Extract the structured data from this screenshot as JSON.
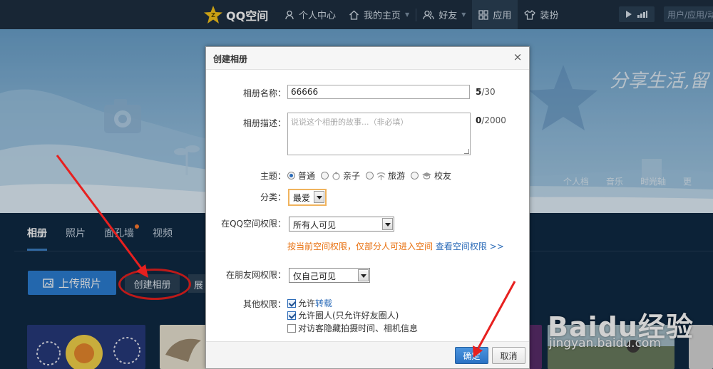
{
  "topbar": {
    "logo_text": "QQ空间",
    "nav": [
      {
        "label": "个人中心",
        "icon": "user-icon"
      },
      {
        "label": "我的主页",
        "icon": "home-icon"
      },
      {
        "label": "好友",
        "icon": "friends-icon"
      },
      {
        "label": "应用",
        "icon": "apps-grid-icon",
        "active": true
      },
      {
        "label": "装扮",
        "icon": "shirt-icon"
      }
    ],
    "search_placeholder": "用户/应用/动"
  },
  "hero": {
    "slogan": "分享生活,留",
    "tabs": [
      "个人档",
      "音乐",
      "时光轴",
      "更"
    ]
  },
  "album_page": {
    "tabs": [
      "相册",
      "照片",
      "面孔墙",
      "视频"
    ],
    "active_tab": "相册",
    "upload_label": "上传照片",
    "create_album_label": "创建相册",
    "more_label": "展"
  },
  "dialog": {
    "title": "创建相册",
    "close_symbol": "×",
    "name_label": "相册名称：",
    "name_value": "66666",
    "name_count": "5",
    "name_max": "/30",
    "desc_label": "相册描述：",
    "desc_placeholder": "说说这个相册的故事...（非必填）",
    "desc_count": "0",
    "desc_max": "/2000",
    "theme_label": "主题：",
    "themes": [
      "普通",
      "亲子",
      "旅游",
      "校友"
    ],
    "selected_theme": "普通",
    "category_label": "分类：",
    "category_value": "最爱",
    "qzone_perm_label": "在QQ空间权限：",
    "qzone_perm_value": "所有人可见",
    "perm_note": "按当前空间权限，仅部分人可进入空间",
    "perm_link": "查看空间权限 >>",
    "pengyou_perm_label": "在朋友网权限：",
    "pengyou_perm_value": "仅自己可见",
    "other_perm_label": "其他权限：",
    "allow_prefix": "允许",
    "repost_link": "转载",
    "circle_option": "允许圈人(只允许好友圈人)",
    "hide_exif_option": "对访客隐藏拍摄时间、相机信息",
    "ok_label": "确定",
    "cancel_label": "取消"
  },
  "watermark": {
    "brand": "Baidu经验",
    "url": "jingyan.baidu.com"
  },
  "colors": {
    "nav_bg": "#1e2f41",
    "page_bg": "#0f2a44",
    "accent_blue": "#2b7ed3",
    "warning_orange": "#e8700f",
    "annotation_red": "#e7201f"
  }
}
